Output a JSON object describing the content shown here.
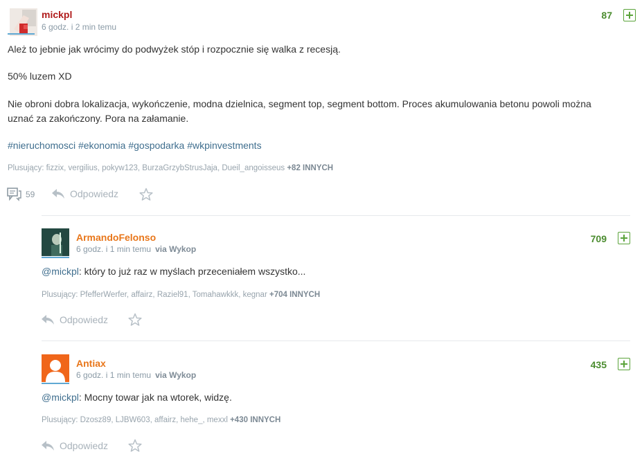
{
  "main_post": {
    "author": "mickpl",
    "time": "6 godz. i 2 min temu",
    "votes": "87",
    "line1": "Ależ to jebnie jak wrócimy do podwyżek stóp i rozpocznie się walka z recesją.",
    "line2": "50% luzem XD",
    "line3a": "Nie obroni dobra lokalizacja, wykończenie, modna dzielnica, segment top, segment bottom. Proces akumulowania betonu powoli można",
    "line3b": "uznać za zakończony. Pora na załamanie.",
    "tags": [
      "#nieruchomosci",
      "#ekonomia",
      "#gospodarka",
      "#wkpinvestments"
    ],
    "voters_prefix": "Plusujący: fizzix, vergilius, pokyw123, BurzaGrzybStrusJaja, Dueil_angoisseus",
    "voters_more": "+82 INNYCH",
    "comment_count": "59",
    "reply_label": "Odpowiedz"
  },
  "replies": [
    {
      "author": "ArmandoFelonso",
      "time": "6 godz. i 1 min temu",
      "via": "via Wykop",
      "votes": "709",
      "mention": "@mickpl",
      "text": ": który to już raz w myślach przeceniałem wszystko...",
      "voters_prefix": "Plusujący: PfefferWerfer, affairz, Raziel91, Tomahawkkk, kegnar",
      "voters_more": "+704 INNYCH",
      "reply_label": "Odpowiedz"
    },
    {
      "author": "Antiax",
      "time": "6 godz. i 1 min temu",
      "via": "via Wykop",
      "votes": "435",
      "mention": "@mickpl",
      "text": ": Mocny towar jak na wtorek, widzę.",
      "voters_prefix": "Plusujący: Dzosz89, LJBW603, affairz, hehe_, mexxl",
      "voters_more": "+430 INNYCH",
      "reply_label": "Odpowiedz"
    }
  ],
  "colors": {
    "author_main": "#b01b1b",
    "author_reply": "#e8761a",
    "vote_green": "#4b8c2f",
    "link_blue": "#3f6e8e"
  }
}
